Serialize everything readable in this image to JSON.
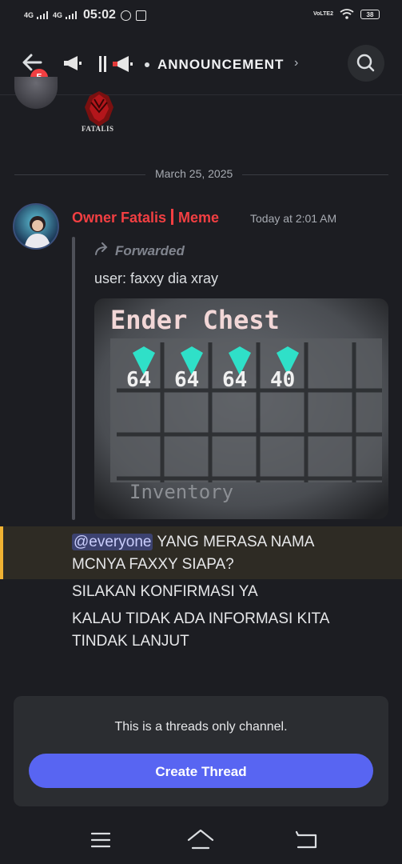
{
  "status_bar": {
    "network1": "4G",
    "network2": "4G",
    "time": "05:02",
    "volte": "VoLTE2",
    "battery": "38"
  },
  "header": {
    "notification_count": "5",
    "channel_name": "ANNOUNCEMENT",
    "chevron": "›"
  },
  "previous_message": {
    "logo_text": "FATALIS"
  },
  "date_divider": "March 25, 2025",
  "message": {
    "author": "Owner Fatalis",
    "author_suffix": "Meme",
    "author_color": "#f23f42",
    "timestamp": "Today at 2:01 AM",
    "forwarded_label": "Forwarded",
    "forwarded_text": "user: faxxy dia xray",
    "image_text": {
      "title": "Ender Chest",
      "counts": [
        "64",
        "64",
        "64",
        "40"
      ],
      "footer": "Inventory"
    },
    "mention": "@everyone",
    "line1_rest": " YANG MERASA NAMA",
    "line2": "MCNYA FAXXY SIAPA?",
    "line3": "SILAKAN KONFIRMASI YA",
    "line4": "KALAU TIDAK ADA INFORMASI KITA",
    "line5": "TINDAK LANJUT"
  },
  "threads": {
    "info": "This is a threads only channel.",
    "button_label": "Create Thread",
    "button_color": "#5865f2"
  },
  "icons": [
    "back-arrow-icon",
    "megaphone-icon",
    "search-icon",
    "forward-icon",
    "menu-icon",
    "home-icon",
    "nav-back-icon"
  ]
}
